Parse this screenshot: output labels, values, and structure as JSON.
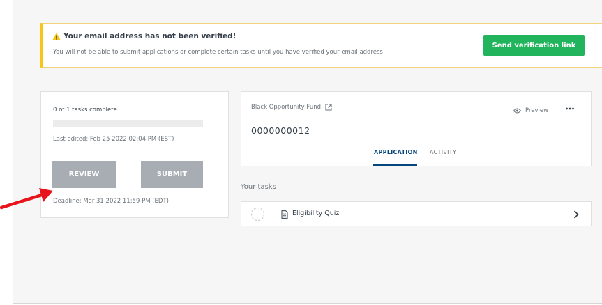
{
  "alert": {
    "title": "Your email address has not been verified!",
    "message": "You will not be able to submit applications or complete certain tasks until you have verified your email address",
    "button_label": "Send verification link",
    "icon": "warning-icon"
  },
  "progress_card": {
    "tasks_complete": "0 of 1 tasks complete",
    "progress_fraction": 0,
    "last_edited": "Last edited: Feb 25 2022 02:04 PM (EST)",
    "review_label": "REVIEW",
    "submit_label": "SUBMIT",
    "deadline": "Deadline: Mar 31 2022 11:59 PM (EDT)"
  },
  "application": {
    "fund_name": "Black Opportunity Fund",
    "id": "0000000012",
    "preview_label": "Preview",
    "tabs": [
      {
        "label": "APPLICATION",
        "active": true
      },
      {
        "label": "ACTIVITY",
        "active": false
      }
    ]
  },
  "tasks": {
    "heading": "Your tasks",
    "items": [
      {
        "name": "Eligibility Quiz",
        "status": "incomplete"
      }
    ]
  },
  "colors": {
    "accent_green": "#21b45d",
    "warning_yellow": "#f5c518",
    "tab_active": "#05467e",
    "disabled_button": "#a7adb2",
    "annotation_arrow": "#e8141b"
  }
}
